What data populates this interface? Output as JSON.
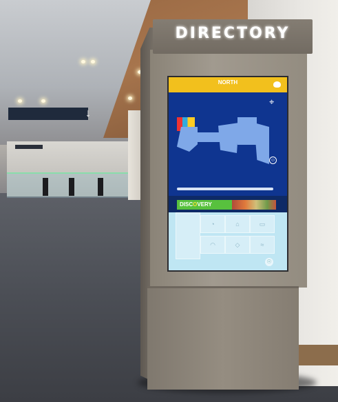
{
  "kiosk": {
    "title": "DIRECTORY"
  },
  "screen": {
    "header_title": "NORTH",
    "discovery_label_pre": "DISC",
    "discovery_label_o": "O",
    "discovery_label_post": "VERY"
  },
  "colors": {
    "screen_header": "#f2c01d",
    "map_background": "#0f3590",
    "discovery_green": "#58c13e",
    "tile_background": "#d6eef7"
  },
  "icons": [
    "compass-icon",
    "person-icon",
    "home-icon",
    "pedestrian-icon",
    "arrow-down-icon"
  ]
}
